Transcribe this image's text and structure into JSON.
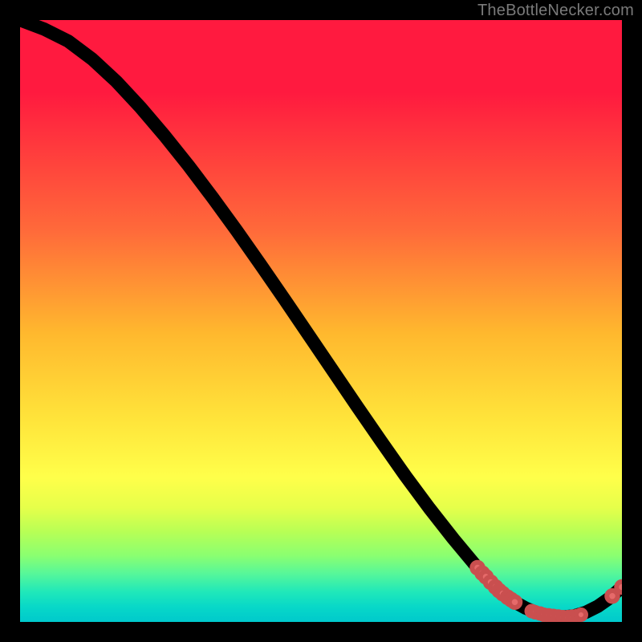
{
  "source_label": "TheBottleNecker.com",
  "colors": {
    "page_bg": "#000000",
    "curve": "#000000",
    "dot_fill": "#e66a6a",
    "dot_stroke": "#c94f4f",
    "label": "#7a7a7a"
  },
  "chart_data": {
    "type": "line",
    "title": "",
    "xlabel": "",
    "ylabel": "",
    "xlim": [
      0,
      100
    ],
    "ylim": [
      0,
      100
    ],
    "x": [
      0,
      4,
      8,
      12,
      16,
      20,
      24,
      28,
      32,
      36,
      40,
      44,
      48,
      52,
      56,
      60,
      64,
      68,
      72,
      76,
      78,
      80,
      82,
      84,
      86,
      88,
      90,
      92,
      94,
      96,
      98,
      100
    ],
    "values": [
      100,
      98.5,
      96.5,
      93.5,
      89.8,
      85.5,
      80.8,
      75.8,
      70.5,
      65.0,
      59.3,
      53.5,
      47.6,
      41.7,
      35.8,
      30.0,
      24.3,
      18.9,
      13.8,
      9.0,
      6.8,
      4.9,
      3.4,
      2.3,
      1.5,
      1.0,
      0.8,
      1.0,
      1.6,
      2.6,
      4.0,
      5.8
    ],
    "dot_cluster_1": [
      {
        "x": 76.0,
        "y": 9.0
      },
      {
        "x": 76.8,
        "y": 8.1
      },
      {
        "x": 77.4,
        "y": 7.5
      },
      {
        "x": 78.2,
        "y": 6.6
      },
      {
        "x": 79.0,
        "y": 5.8
      },
      {
        "x": 79.6,
        "y": 5.2
      },
      {
        "x": 80.2,
        "y": 4.7
      },
      {
        "x": 81.0,
        "y": 4.1
      },
      {
        "x": 81.6,
        "y": 3.7
      },
      {
        "x": 82.2,
        "y": 3.3
      }
    ],
    "dot_cluster_2": [
      {
        "x": 85.0,
        "y": 1.8
      },
      {
        "x": 85.6,
        "y": 1.6
      },
      {
        "x": 86.4,
        "y": 1.4
      },
      {
        "x": 87.0,
        "y": 1.2
      },
      {
        "x": 87.8,
        "y": 1.1
      },
      {
        "x": 88.6,
        "y": 1.0
      },
      {
        "x": 89.4,
        "y": 0.9
      },
      {
        "x": 90.2,
        "y": 0.8
      },
      {
        "x": 91.0,
        "y": 0.8
      },
      {
        "x": 91.8,
        "y": 0.9
      },
      {
        "x": 92.6,
        "y": 1.0
      },
      {
        "x": 93.2,
        "y": 1.2
      }
    ],
    "dot_cluster_3": [
      {
        "x": 98.4,
        "y": 4.3
      },
      {
        "x": 100.0,
        "y": 5.8
      }
    ]
  }
}
